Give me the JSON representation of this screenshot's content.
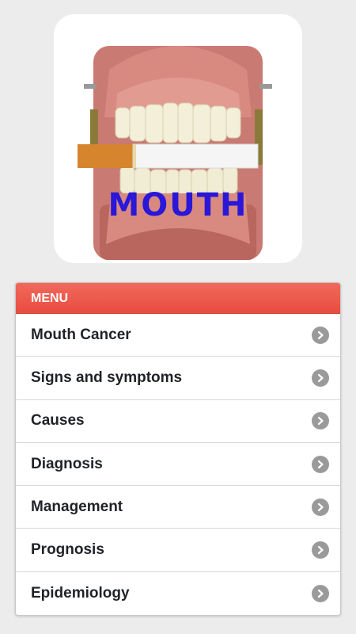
{
  "hero": {
    "image_icon": "dentures-with-cigarette-illustration",
    "overlay_text": "MOUTH"
  },
  "menu": {
    "header": "MENU",
    "accent_color": "#e94c3f",
    "items": [
      {
        "label": "Mouth Cancer",
        "icon": "chevron-right-circle-icon"
      },
      {
        "label": "Signs and symptoms",
        "icon": "chevron-right-circle-icon"
      },
      {
        "label": "Causes",
        "icon": "chevron-right-circle-icon"
      },
      {
        "label": "Diagnosis",
        "icon": "chevron-right-circle-icon"
      },
      {
        "label": "Management",
        "icon": "chevron-right-circle-icon"
      },
      {
        "label": "Prognosis",
        "icon": "chevron-right-circle-icon"
      },
      {
        "label": "Epidemiology",
        "icon": "chevron-right-circle-icon"
      }
    ]
  }
}
